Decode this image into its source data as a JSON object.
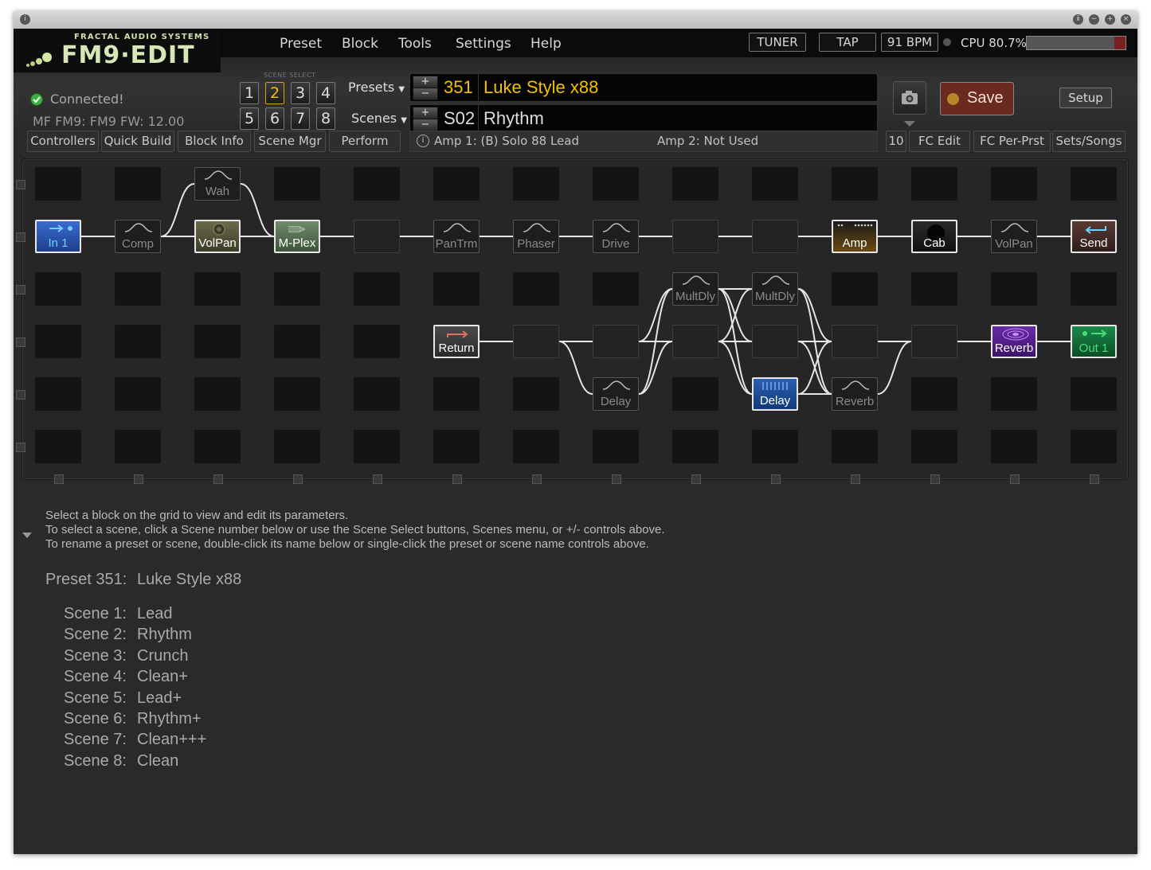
{
  "app": {
    "brand_sub": "FRACTAL AUDIO SYSTEMS",
    "brand_main": "FM9·EDIT"
  },
  "menu": [
    "Preset",
    "Block",
    "Tools",
    "Settings",
    "Help"
  ],
  "header": {
    "tuner": "TUNER",
    "tap": "TAP",
    "bpm": "91 BPM",
    "cpu": "CPU 80.7%",
    "cpu_percent": 80.7,
    "connected": "Connected!",
    "device_info": "MF FM9: FM9 FW: 12.00",
    "scene_select_label": "SCENE SELECT",
    "scene_buttons": [
      "1",
      "2",
      "3",
      "4",
      "5",
      "6",
      "7",
      "8"
    ],
    "active_scene": "2",
    "presets_label": "Presets",
    "scenes_label": "Scenes",
    "preset_number": "351",
    "preset_name": "Luke Style x88",
    "scene_number": "S02",
    "scene_name": "Rhythm",
    "plus": "+",
    "minus": "−",
    "save": "Save",
    "setup": "Setup"
  },
  "toolbar": {
    "left_buttons": [
      "Controllers",
      "Quick Build",
      "Block Info",
      "Scene Mgr",
      "Perform"
    ],
    "amp1": "Amp 1: (B) Solo 88 Lead",
    "amp2": "Amp 2: Not Used",
    "fc_number": "10",
    "right_buttons": [
      "FC Edit",
      "FC Per-Prst",
      "Sets/Songs"
    ]
  },
  "grid": {
    "blocks": [
      {
        "col": 0,
        "row": 1,
        "label": "In 1",
        "style": "in"
      },
      {
        "col": 1,
        "row": 1,
        "label": "Comp",
        "style": "dim"
      },
      {
        "col": 2,
        "row": 0,
        "label": "Wah",
        "style": "dim"
      },
      {
        "col": 2,
        "row": 1,
        "label": "VolPan",
        "style": "volpan"
      },
      {
        "col": 3,
        "row": 1,
        "label": "M-Plex",
        "style": "mplex"
      },
      {
        "col": 4,
        "row": 1,
        "label": "",
        "style": "empty"
      },
      {
        "col": 5,
        "row": 1,
        "label": "PanTrm",
        "style": "dim"
      },
      {
        "col": 6,
        "row": 1,
        "label": "Phaser",
        "style": "dim"
      },
      {
        "col": 7,
        "row": 1,
        "label": "Drive",
        "style": "dim"
      },
      {
        "col": 8,
        "row": 1,
        "label": "",
        "style": "empty"
      },
      {
        "col": 9,
        "row": 1,
        "label": "",
        "style": "empty"
      },
      {
        "col": 10,
        "row": 1,
        "label": "Amp",
        "style": "amp"
      },
      {
        "col": 11,
        "row": 1,
        "label": "Cab",
        "style": "cab"
      },
      {
        "col": 12,
        "row": 1,
        "label": "VolPan",
        "style": "dim"
      },
      {
        "col": 13,
        "row": 1,
        "label": "Send",
        "style": "send"
      },
      {
        "col": 8,
        "row": 2,
        "label": "MultDly",
        "style": "dim"
      },
      {
        "col": 9,
        "row": 2,
        "label": "MultDly",
        "style": "dim"
      },
      {
        "col": 5,
        "row": 3,
        "label": "Return",
        "style": "return"
      },
      {
        "col": 6,
        "row": 3,
        "label": "",
        "style": "empty"
      },
      {
        "col": 7,
        "row": 3,
        "label": "",
        "style": "empty"
      },
      {
        "col": 8,
        "row": 3,
        "label": "",
        "style": "empty"
      },
      {
        "col": 9,
        "row": 3,
        "label": "",
        "style": "empty"
      },
      {
        "col": 10,
        "row": 3,
        "label": "",
        "style": "empty"
      },
      {
        "col": 11,
        "row": 3,
        "label": "",
        "style": "empty"
      },
      {
        "col": 12,
        "row": 3,
        "label": "Reverb",
        "style": "reverb"
      },
      {
        "col": 13,
        "row": 3,
        "label": "Out 1",
        "style": "out"
      },
      {
        "col": 7,
        "row": 4,
        "label": "Delay",
        "style": "dim"
      },
      {
        "col": 9,
        "row": 4,
        "label": "Delay",
        "style": "delay"
      },
      {
        "col": 10,
        "row": 4,
        "label": "Reverb",
        "style": "dim"
      }
    ],
    "connections": [
      [
        0,
        1,
        1,
        1
      ],
      [
        1,
        1,
        2,
        1
      ],
      [
        1,
        1,
        2,
        0
      ],
      [
        2,
        0,
        3,
        1
      ],
      [
        2,
        1,
        3,
        1
      ],
      [
        3,
        1,
        4,
        1
      ],
      [
        4,
        1,
        5,
        1
      ],
      [
        5,
        1,
        6,
        1
      ],
      [
        6,
        1,
        7,
        1
      ],
      [
        7,
        1,
        8,
        1
      ],
      [
        8,
        1,
        9,
        1
      ],
      [
        9,
        1,
        10,
        1
      ],
      [
        10,
        1,
        11,
        1
      ],
      [
        11,
        1,
        12,
        1
      ],
      [
        12,
        1,
        13,
        1
      ],
      [
        5,
        3,
        6,
        3
      ],
      [
        6,
        3,
        7,
        3
      ],
      [
        6,
        3,
        7,
        4
      ],
      [
        7,
        3,
        8,
        3
      ],
      [
        7,
        3,
        8,
        2
      ],
      [
        7,
        4,
        8,
        3
      ],
      [
        7,
        4,
        8,
        2
      ],
      [
        8,
        2,
        9,
        2
      ],
      [
        8,
        2,
        9,
        3
      ],
      [
        8,
        2,
        9,
        4
      ],
      [
        8,
        3,
        9,
        3
      ],
      [
        8,
        3,
        9,
        2
      ],
      [
        8,
        3,
        9,
        4
      ],
      [
        9,
        2,
        10,
        3
      ],
      [
        9,
        2,
        10,
        4
      ],
      [
        9,
        3,
        10,
        3
      ],
      [
        9,
        3,
        10,
        4
      ],
      [
        9,
        4,
        10,
        3
      ],
      [
        9,
        4,
        10,
        4
      ],
      [
        10,
        3,
        11,
        3
      ],
      [
        10,
        4,
        11,
        3
      ],
      [
        11,
        3,
        12,
        3
      ],
      [
        12,
        3,
        13,
        3
      ]
    ]
  },
  "info": {
    "lines": [
      "Select a block on the grid to view and edit its parameters.",
      "To select a scene, click a Scene number below or use the Scene Select buttons, Scenes menu, or +/- controls above.",
      "To rename a preset or scene, double-click its name below or single-click the preset or scene name controls above."
    ],
    "preset_label": "Preset 351:",
    "preset_name": "Luke Style x88",
    "scenes": [
      {
        "key": "Scene 1:",
        "name": "Lead"
      },
      {
        "key": "Scene 2:",
        "name": "Rhythm"
      },
      {
        "key": "Scene 3:",
        "name": "Crunch"
      },
      {
        "key": "Scene 4:",
        "name": "Clean+"
      },
      {
        "key": "Scene 5:",
        "name": "Lead+"
      },
      {
        "key": "Scene 6:",
        "name": "Rhythm+"
      },
      {
        "key": "Scene 7:",
        "name": "Clean+++"
      },
      {
        "key": "Scene 8:",
        "name": "Clean"
      }
    ]
  },
  "colors": {
    "accent_yellow": "#f4c000",
    "connected_green": "#3cb043",
    "save_bg": "#6a2a1f"
  }
}
